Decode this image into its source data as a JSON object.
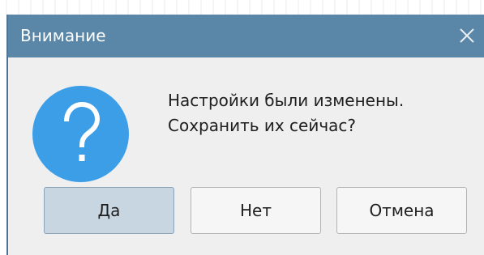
{
  "dialog": {
    "title": "Внимание",
    "close_icon": "close-icon",
    "question_icon": "question-mark-icon",
    "message_lines": [
      "Настройки были изменены.",
      "Сохранить их сейчас?"
    ],
    "buttons": {
      "yes": "Да",
      "no": "Нет",
      "cancel": "Отмена"
    }
  },
  "colors": {
    "titlebar": "#5a86a7",
    "icon_fill": "#3d9ee8",
    "default_button": "#c8d6e1"
  }
}
